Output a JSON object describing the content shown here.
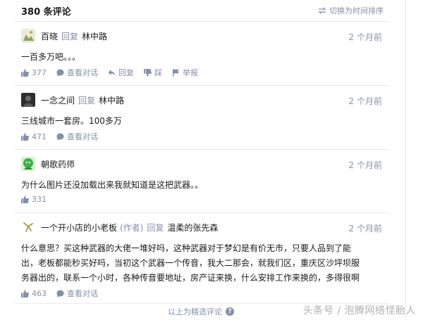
{
  "header": {
    "count": "380 条评论",
    "sort_label": "切换为时间排序"
  },
  "comments": [
    {
      "author": "百晓",
      "reply_label": "回复",
      "reply_to": "林中路",
      "time": "2 个月前",
      "text": "一百多万吧。。。",
      "likes": "377",
      "view_dialog": "查看对话",
      "reply": "回复",
      "dislike": "踩",
      "report": "举报",
      "avatar_color": "#b7c7a0"
    },
    {
      "author": "一念之间",
      "reply_label": "回复",
      "reply_to": "林中路",
      "time": "2 个月前",
      "text": "三线城市一套房。100多万",
      "likes": "471",
      "view_dialog": "查看对话",
      "avatar_color": "#3c3c3c"
    },
    {
      "author": "朝歌药师",
      "time": "2 个月前",
      "text": "为什么图片还没加载出来我就知道是这把武器。。",
      "likes": "331",
      "avatar_color": "#3fb04a"
    },
    {
      "author": "一个开小店的小老板",
      "author_tag": "(作者)",
      "reply_label": "回复",
      "reply_to": "温柔的张先森",
      "time": "2 个月前",
      "text_lines": [
        "什么意思？买这种武器的大佬一堆好吗，这种武器对于梦幻是有价无市，只要人品到了能",
        "出，老板都能秒买好吗，当初这个武器一个传音，我大二那会，就我们区，重庆区沙坪坝服",
        "务器出的，联系一个小时，各种传音要地址，房产证来换，什么安排工作来换的，多得很啊"
      ],
      "likes": "463",
      "view_dialog": "查看对话",
      "avatar_color": "#b0a060"
    }
  ],
  "footer": {
    "text": "以上为精选评论",
    "help": "?"
  },
  "watermark": "头条号 / 泡腾网络怪胎人"
}
